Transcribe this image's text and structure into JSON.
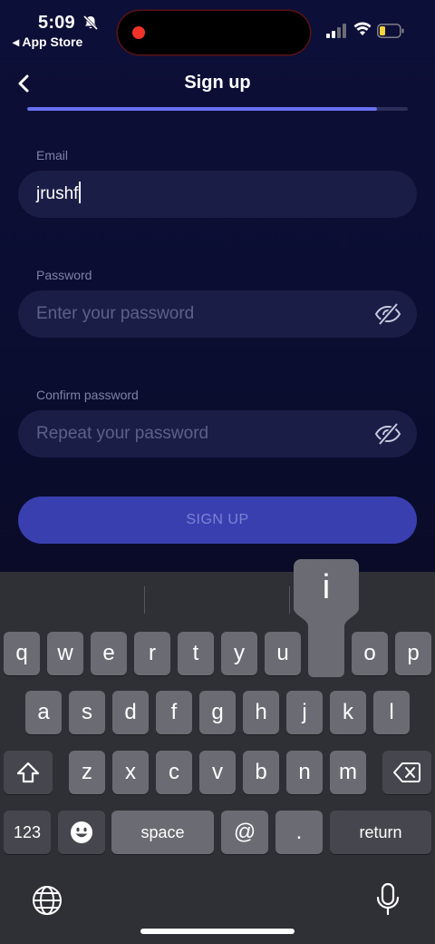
{
  "status_bar": {
    "time": "5:09",
    "back_app_label": "◂ App Store",
    "icons": [
      "bell-slash-icon",
      "signal-icon",
      "wifi-icon",
      "battery-icon"
    ]
  },
  "nav": {
    "title": "Sign up",
    "back_icon": "chevron-left-icon",
    "progress": 0.92
  },
  "form": {
    "email": {
      "label": "Email",
      "value": "jrushf"
    },
    "password": {
      "label": "Password",
      "placeholder": "Enter your password",
      "icon": "eye-slash-icon"
    },
    "confirm": {
      "label": "Confirm password",
      "placeholder": "Repeat your password",
      "icon": "eye-slash-icon"
    },
    "submit_label": "SIGN UP"
  },
  "keyboard": {
    "row1": [
      "q",
      "w",
      "e",
      "r",
      "t",
      "y",
      "u",
      "i",
      "o",
      "p"
    ],
    "row2": [
      "a",
      "s",
      "d",
      "f",
      "g",
      "h",
      "j",
      "k",
      "l"
    ],
    "row3": [
      "z",
      "x",
      "c",
      "v",
      "b",
      "n",
      "m"
    ],
    "numbers_label": "123",
    "space_label": "space",
    "at_label": "@",
    "dot_label": ".",
    "return_label": "return",
    "popup_letter": "i",
    "icons": [
      "shift-icon",
      "backspace-icon",
      "emoji-icon",
      "globe-icon",
      "microphone-icon"
    ]
  },
  "colors": {
    "accent": "#6a6ef0",
    "button": "#3a3fb0",
    "field": "#1a1d45",
    "background": "#0b0d30"
  }
}
